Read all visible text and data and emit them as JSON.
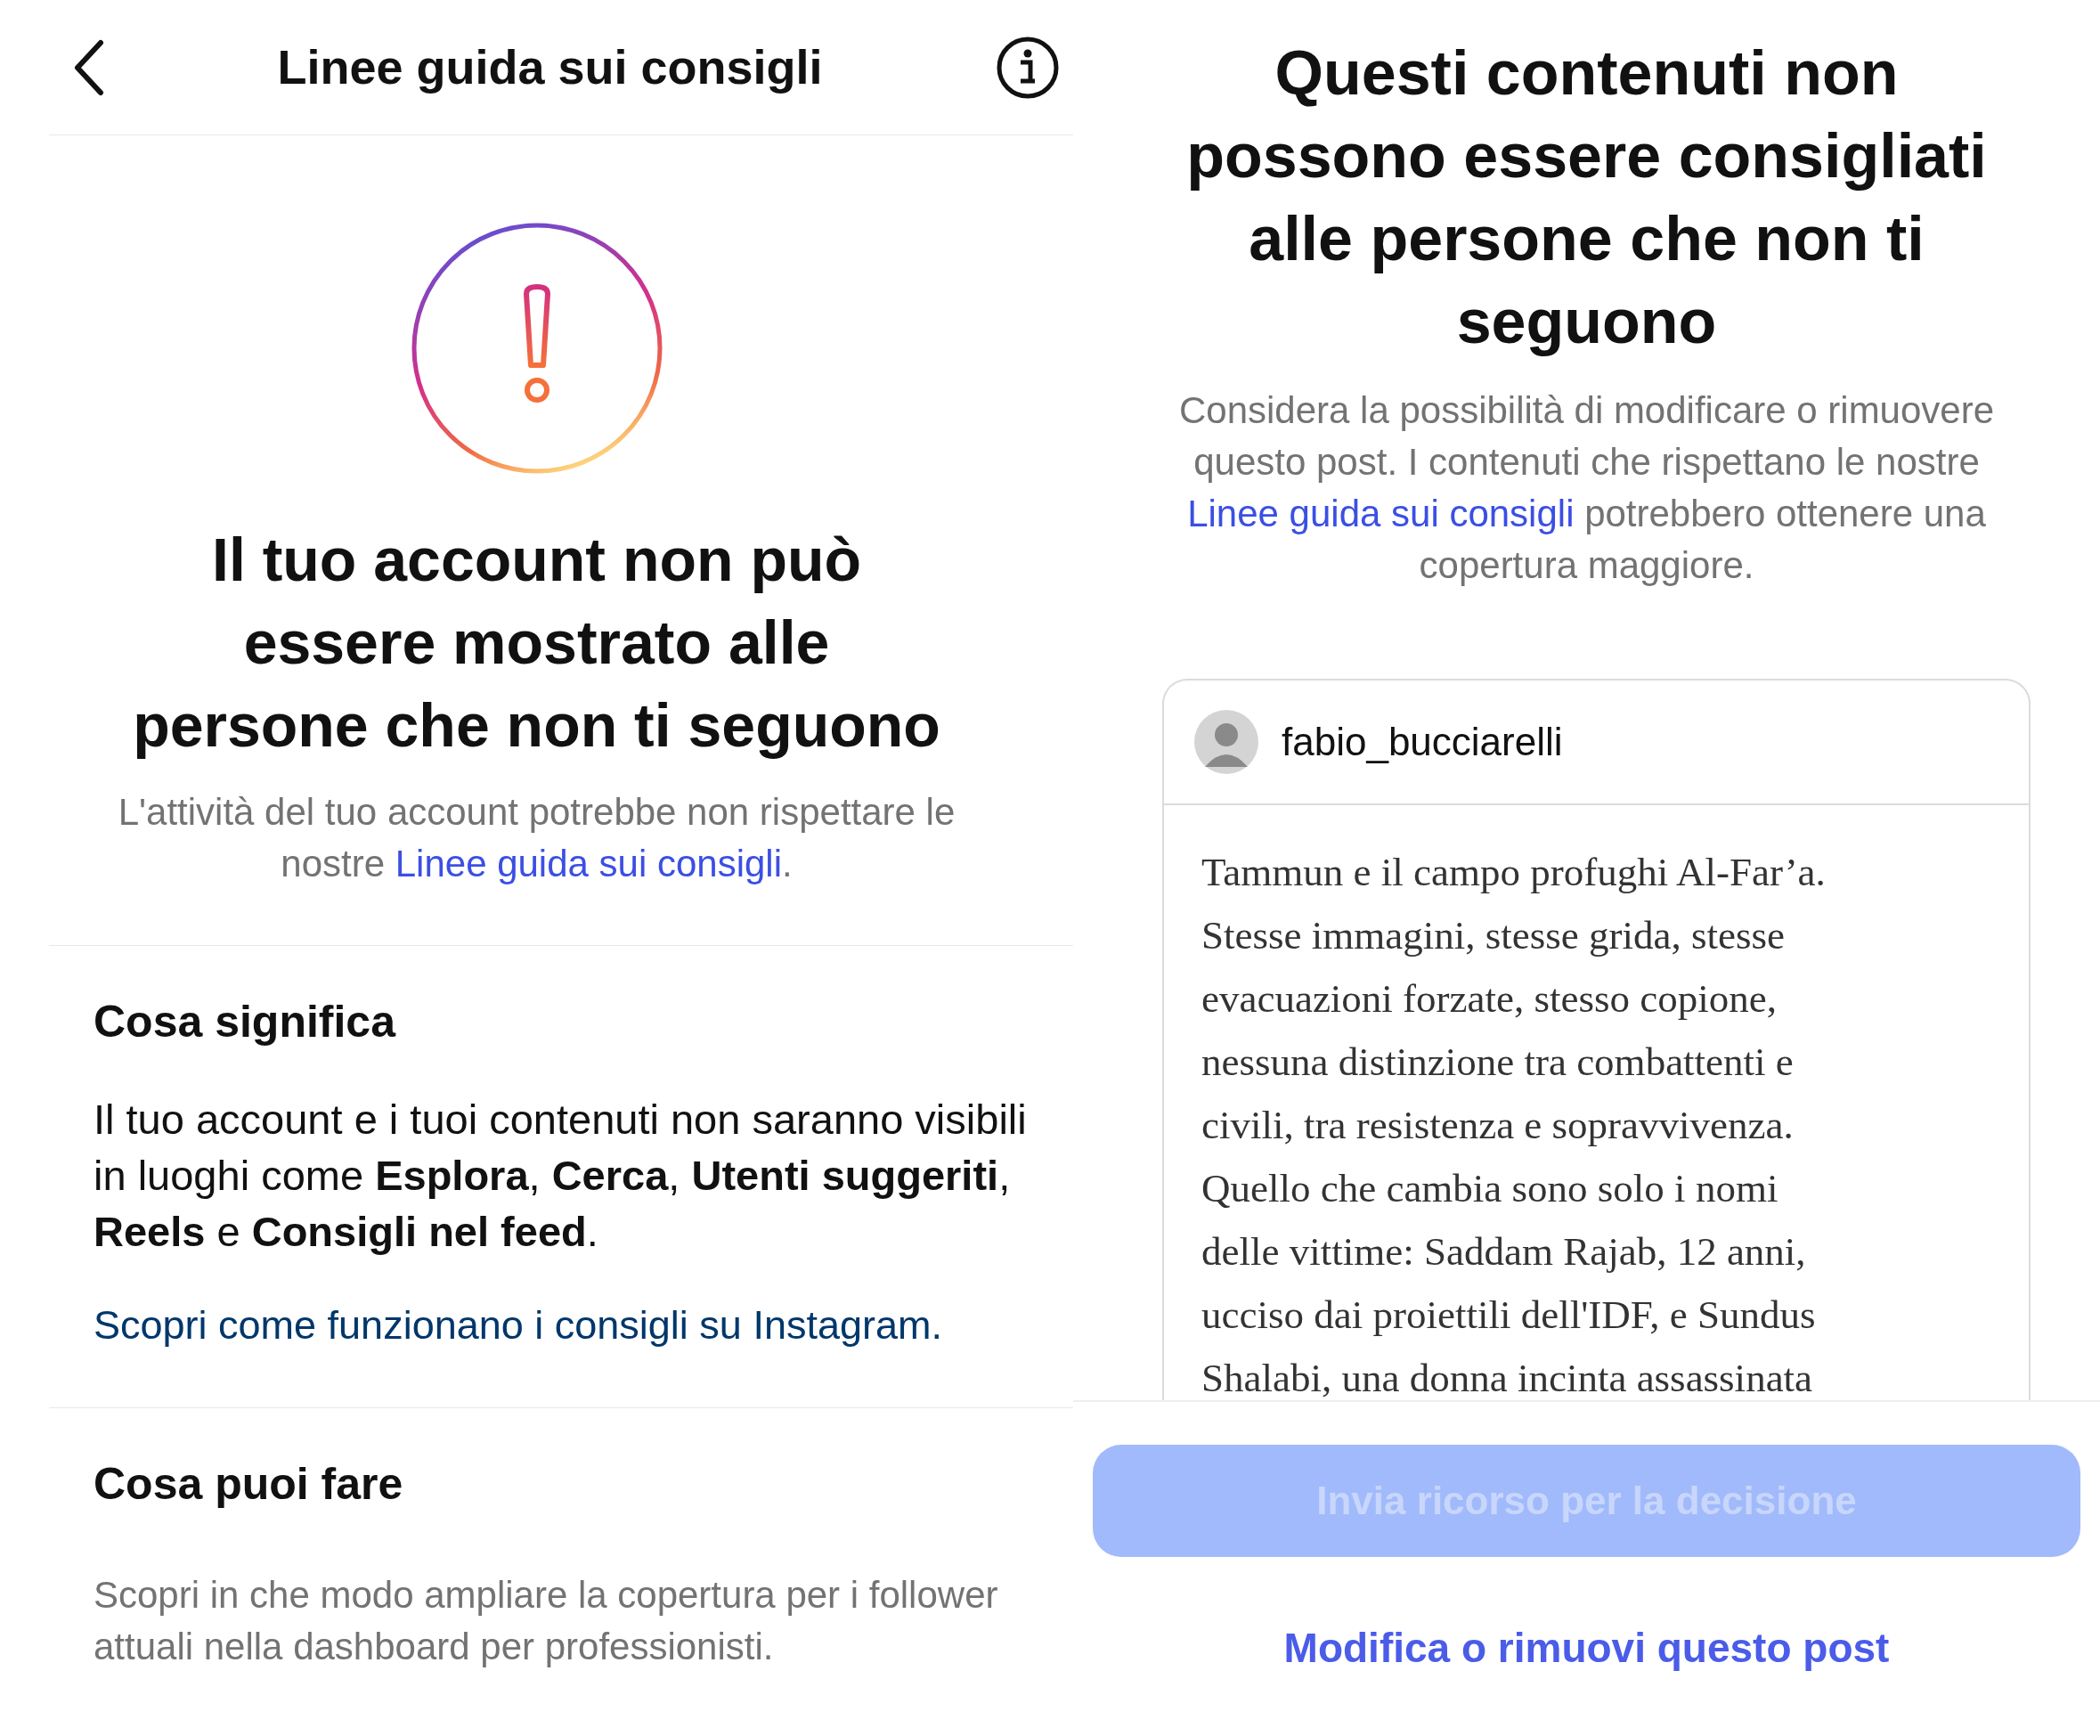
{
  "left": {
    "header": {
      "title": "Linee guida sui consigli"
    },
    "headline": [
      "Il tuo account non può",
      "essere mostrato alle",
      "persone che non ti seguono"
    ],
    "description": {
      "text": "L'attività del tuo account potrebbe non rispettare le nostre ",
      "link": "Linee guida sui consigli",
      "suffix": "."
    },
    "sections": [
      {
        "heading": "Cosa significa",
        "kind": "body",
        "text": "Il tuo account e i tuoi contenuti non saranno visibili in luoghi come **Esplora**, **Cerca**, **Utenti suggeriti**, **Reels** e **Consigli nel feed**.",
        "link": "Scopri come funzionano i consigli su Instagram."
      },
      {
        "heading": "Cosa puoi fare",
        "kind": "note",
        "text": "Scopri in che modo ampliare la copertura per i follower attuali nella dashboard per professionisti."
      }
    ]
  },
  "right": {
    "headline": [
      "Questi contenuti non",
      "possono essere consigliati",
      "alle persone che non ti",
      "seguono"
    ],
    "description": {
      "text": "Considera la possibilità di modificare o rimuovere questo post. I contenuti che rispettano le nostre ",
      "link": "Linee guida sui consigli",
      "suffix": " potrebbero ottenere una copertura maggiore."
    },
    "post": {
      "username": "fabio_bucciarelli",
      "lines": [
        "Tammun e il campo profughi Al-Far’a.",
        "Stesse immagini, stesse grida, stesse",
        "evacuazioni forzate, stesso copione,",
        "nessuna distinzione tra combattenti e",
        "civili, tra resistenza e sopravvivenza.",
        "Quello che cambia sono solo i nomi",
        "delle vittime: Saddam Rajab, 12 anni,",
        "ucciso dai proiettili dell'IDF, e Sundus",
        "Shalabi, una donna incinta assassinata"
      ]
    },
    "buttons": [
      {
        "label": "Invia ricorso per la decisione",
        "kind": "primary",
        "disabled": true
      },
      {
        "label": "Modifica o rimuovi questo post",
        "kind": "link",
        "disabled": false
      }
    ]
  }
}
